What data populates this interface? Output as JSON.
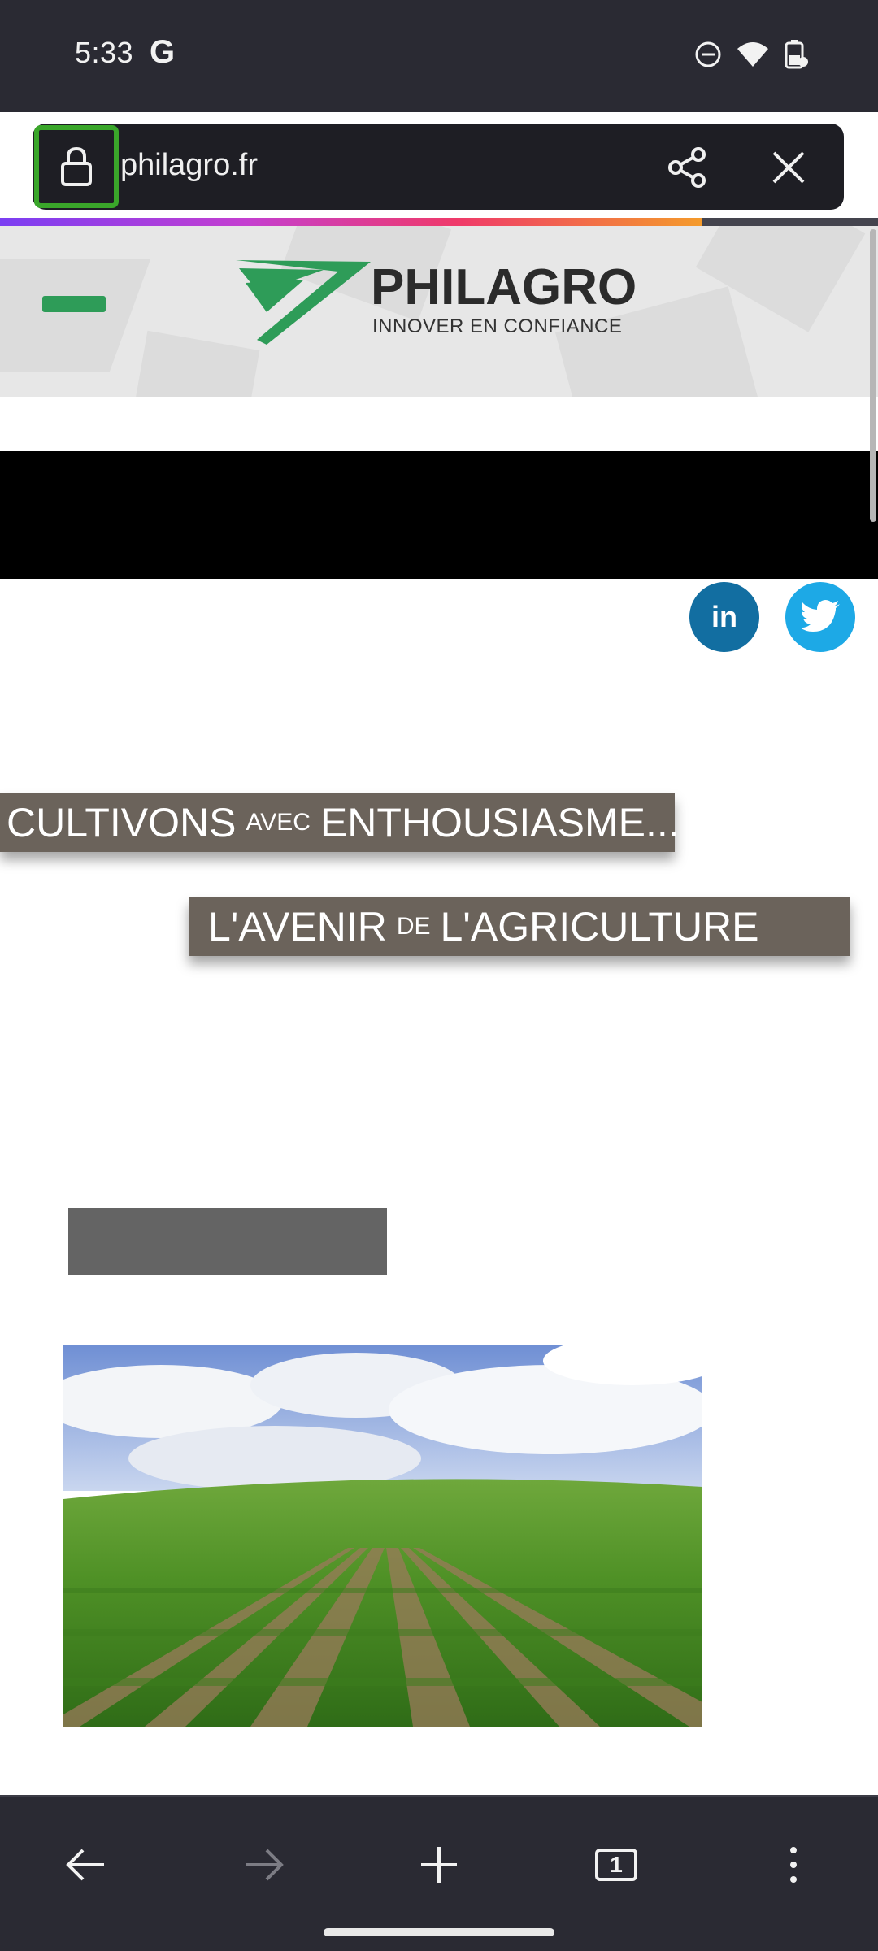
{
  "status_bar": {
    "time": "5:33",
    "google_glyph": "G",
    "icons": [
      "dnd-icon",
      "wifi-icon",
      "battery-saver-icon"
    ]
  },
  "browser": {
    "url": "philagro.fr",
    "load_progress": 0.8,
    "lock_icon": "lock-icon",
    "share_icon": "share-icon",
    "close_icon": "close-icon"
  },
  "site": {
    "logo_name": "PHILAGRO",
    "logo_tagline": "INNOVER EN CONFIANCE",
    "social": {
      "linkedin_label": "in",
      "twitter_icon": "twitter-bird-icon"
    },
    "slogan_line1": {
      "part1": "CULTIVONS",
      "connector": "AVEC",
      "part2": "ENTHOUSIASME..."
    },
    "slogan_line2": {
      "part1": "L'AVENIR",
      "connector": "DE",
      "part2": "L'AGRICULTURE"
    },
    "hero_image": "vineyard-photo"
  },
  "toolbar": {
    "back_icon": "back-arrow-icon",
    "forward_icon": "forward-arrow-icon",
    "new_tab_icon": "plus-icon",
    "tab_count": "1",
    "menu_icon": "more-vert-icon"
  },
  "colors": {
    "brand_green": "#2e9c58",
    "linkedin_blue": "#126ea1",
    "twitter_blue": "#1da9e6",
    "slogan_bg": "#6b635b",
    "focus_outline": "#3aa62a"
  }
}
